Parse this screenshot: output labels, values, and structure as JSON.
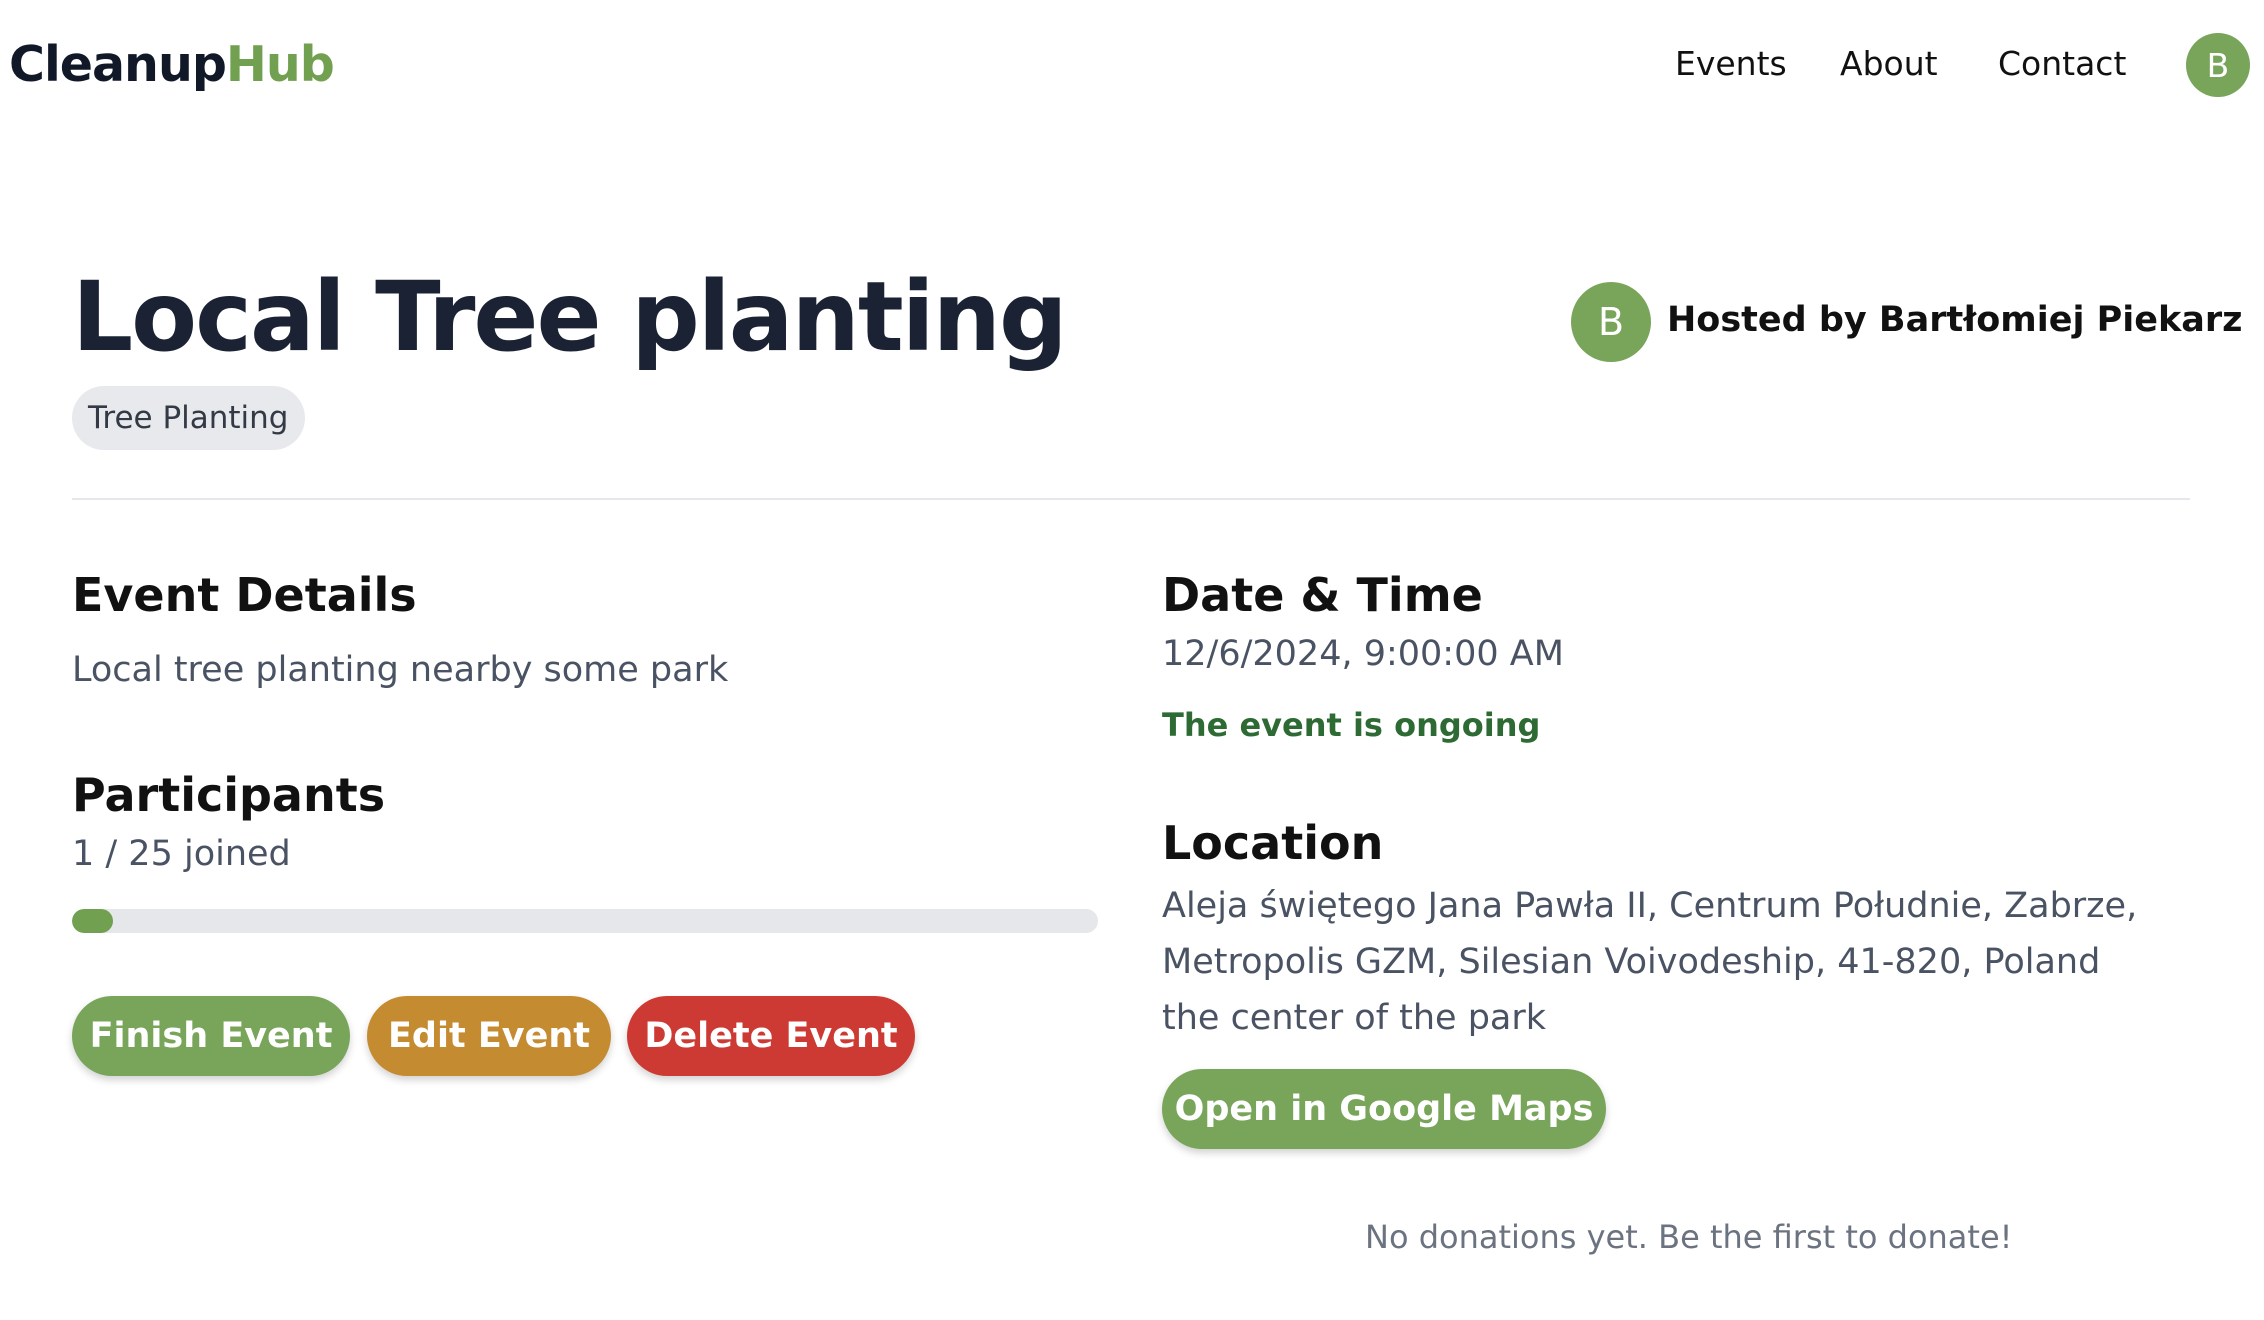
{
  "brand": {
    "name_main": "Cleanup",
    "name_accent": "Hub"
  },
  "nav": {
    "links": [
      "Events",
      "About",
      "Contact"
    ],
    "avatar_initial": "B"
  },
  "event": {
    "title": "Local Tree planting",
    "category": "Tree Planting",
    "host": {
      "initial": "B",
      "text": "Hosted by Bartłomiej Piekarz"
    }
  },
  "details": {
    "heading": "Event Details",
    "description": "Local tree planting nearby some park"
  },
  "participants": {
    "heading": "Participants",
    "count_text": "1 / 25 joined",
    "joined": 1,
    "capacity": 25,
    "progress_fraction": 0.04
  },
  "actions": {
    "finish": "Finish Event",
    "edit": "Edit Event",
    "delete": "Delete Event"
  },
  "datetime": {
    "heading": "Date & Time",
    "value": "12/6/2024, 9:00:00 AM",
    "status": "The event is ongoing"
  },
  "location": {
    "heading": "Location",
    "address_lines": [
      "Aleja świętego Jana Pawła II, Centrum Południe, Zabrze,",
      "Metropolis GZM, Silesian Voivodeship, 41-820, Poland",
      "the center of the park"
    ],
    "maps_button": "Open in Google Maps"
  },
  "donations": {
    "empty_text": "No donations yet. Be the first to donate!"
  },
  "colors": {
    "brand_green": "#71a050",
    "button_green": "#78a55a",
    "button_orange": "#c48b30",
    "button_red": "#cc3a33",
    "status_green": "#2e6b34"
  }
}
